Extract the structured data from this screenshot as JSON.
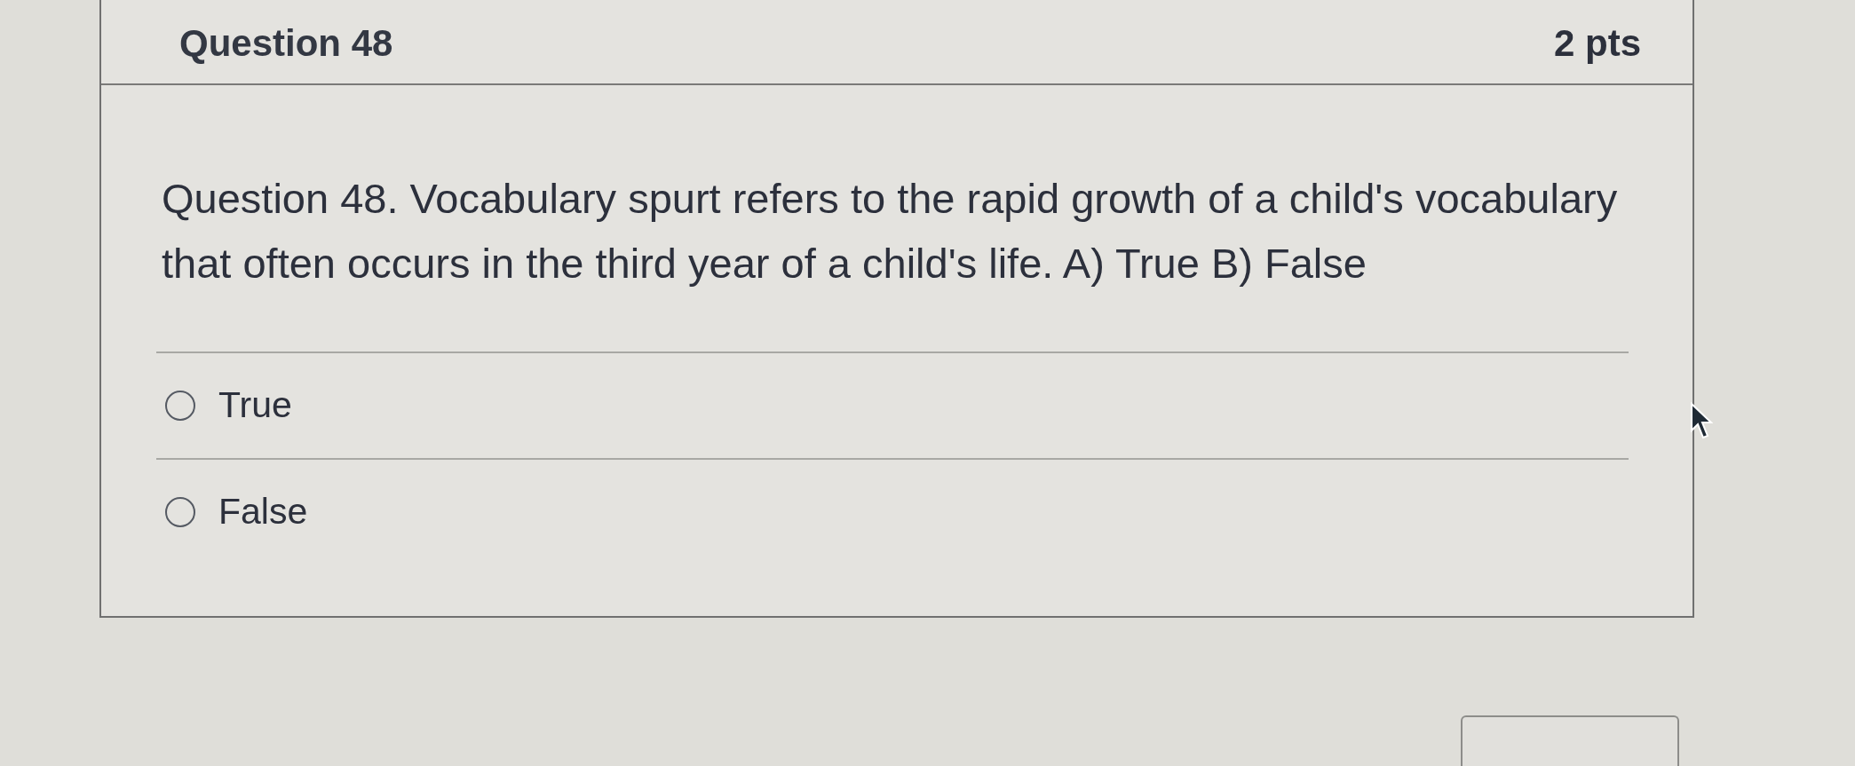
{
  "quiz": {
    "question_title": "Question 48",
    "points": "2 pts",
    "question_text": "Question 48. Vocabulary spurt refers to the rapid growth of a child's vocabulary that often occurs in the third year of a child's life. A) True B) False",
    "answers": [
      {
        "label": "True",
        "selected": false
      },
      {
        "label": "False",
        "selected": false
      }
    ]
  }
}
